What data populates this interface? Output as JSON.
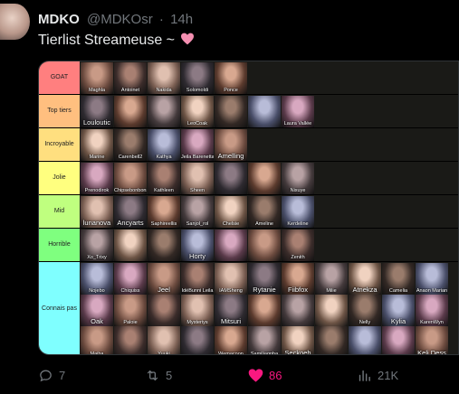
{
  "tweet": {
    "author_name": "MDKO",
    "author_handle": "@MDKOsr",
    "separator": "·",
    "time": "14h",
    "text": "Tierlist Streameuse ~",
    "emoji": "pink-heart-icon"
  },
  "tierlist": {
    "rows": [
      {
        "label": "GOAT",
        "color": "#ff7f7f",
        "items": [
          "Maghla",
          "Antoinet",
          "Nakida",
          "Solomoldi",
          "Ponce"
        ]
      },
      {
        "label": "Top tiers",
        "color": "#ffbf7f",
        "items": [
          "Louloutic",
          "",
          "",
          "LeoCoak",
          "",
          "",
          "Laura Vallée"
        ]
      },
      {
        "label": "Incroyable",
        "color": "#ffdf7f",
        "items": [
          "Marine",
          "Carenbell2",
          "Kathya",
          "Jeila Barenetta",
          "Amelling"
        ]
      },
      {
        "label": "Jolie",
        "color": "#ffff7f",
        "items": [
          "Prenodirok",
          "Chipsebonbons",
          "Kathleen",
          "Sheen",
          "",
          "",
          "Nixuye"
        ]
      },
      {
        "label": "Mid",
        "color": "#bfff7f",
        "items": [
          "lunanova",
          "Ancyarts",
          "Saphireellis",
          "Sanjol_rol",
          "Chelsie",
          "Ameline",
          "Kerdeline"
        ]
      },
      {
        "label": "Horrible",
        "color": "#7fff7f",
        "items": [
          "Xo_Trixy",
          "",
          "",
          "Horty",
          "",
          "",
          "Zenith"
        ]
      },
      {
        "label": "Connais pas",
        "color": "#7fffff",
        "items": [
          "Nojebo",
          "Chiquiss",
          "Jeel",
          "IdéBunni Leila",
          "IAMSheng",
          "Rytanie",
          "Fiibfox",
          "Milie",
          "Atnekza",
          "Camelia",
          "Anaon Marian",
          "Oak",
          "Paloie",
          "",
          "Mysteriys",
          "Mitsuri",
          "",
          "",
          "",
          "Nelly",
          "Kylia",
          "KarenWyn",
          "Maiha",
          "",
          "Yuuki",
          "",
          "Wemacoon",
          "Samiliaqpha",
          "Seckoeh",
          "",
          "",
          "",
          "Keli Dess"
        ]
      }
    ]
  },
  "actions": {
    "replies": "7",
    "retweets": "5",
    "likes": "86",
    "views": "21K"
  },
  "colors": {
    "like_accent": "#f91880",
    "muted": "#71767b"
  }
}
